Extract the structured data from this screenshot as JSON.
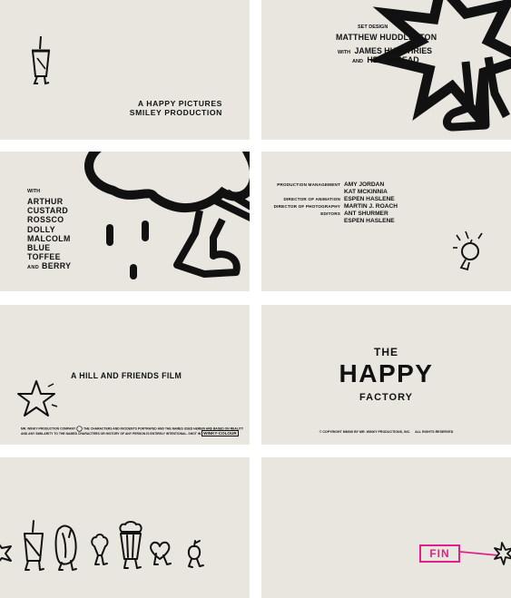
{
  "panel1": {
    "line1": "A HAPPY PICTURES",
    "line2": "SMILEY PRODUCTION"
  },
  "panel2": {
    "role": "SET DESIGN",
    "name1": "MATTHEW HUDDLESTON",
    "with": "WITH",
    "name2": "JAMES HUMPHRIES",
    "and": "AND",
    "name3": "HELEN READ"
  },
  "panel3": {
    "with": "WITH",
    "names": [
      "ARTHUR",
      "CUSTARD",
      "ROSSCO",
      "DOLLY",
      "MALCOLM",
      "BLUE",
      "TOFFEE"
    ],
    "and": "AND",
    "last": "BERRY"
  },
  "panel4": {
    "credits": [
      {
        "role": "PRODUCTION MANAGEMENT",
        "names": [
          "AMY JORDAN",
          "KAT MCKINNIA"
        ]
      },
      {
        "role": "DIRECTOR OF ANIMATION",
        "names": [
          "ESPEN HASLENE"
        ]
      },
      {
        "role": "DIRECTOR OF PHOTOGRAPHY",
        "names": [
          "MARTIN J. ROACH"
        ]
      },
      {
        "role": "EDITORS",
        "names": [
          "ANT SHURMER",
          "ESPEN HASLENE"
        ]
      }
    ]
  },
  "panel5": {
    "title": "A HILL AND FRIENDS FILM",
    "disclaimer1a": "MR. WINKY PRODUCTION COMPANY",
    "disclaimer1b": "THE CHARACTERS AND INCIDENTS PORTRAYED AND THE NAMES USED HEREIN ARE BASED ON REALITY",
    "disclaimer2a": "AND ANY SIMILARITY TO THE NAMED CHARACTERS OR HISTORY OF ANY PERSON IS ENTIRELY INTENTIONAL. SHOT IN",
    "disclaimer2b": "WINKY-COLOUR"
  },
  "panel6": {
    "the": "THE",
    "happy": "HAPPY",
    "factory": "FACTORY",
    "copyright": "© COPYRIGHT MMXIII BY MR. WINKY PRODUCTIONS, INC.     ALL RIGHTS RESERVED"
  },
  "panel8": {
    "fin": "FIN"
  },
  "colors": {
    "background": "#e8e6df",
    "ink": "#111111",
    "fin_accent": "#e0208a"
  }
}
